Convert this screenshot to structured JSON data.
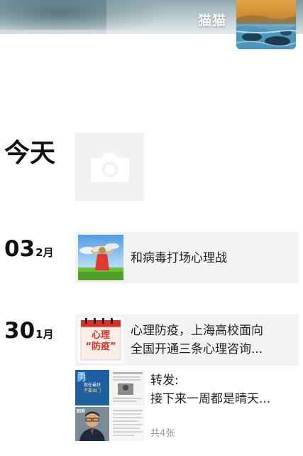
{
  "profile": {
    "nickname": "猫猫",
    "avatar_icon": "landscape-photo-icon"
  },
  "timeline": {
    "today": {
      "label": "今天",
      "placeholder_icon": "camera-icon"
    },
    "entries": [
      {
        "day": "03",
        "month": "2月",
        "text": "和病毒打场心理战",
        "thumb_icon": "girl-in-field-photo-icon"
      },
      {
        "day": "30",
        "month": "1月",
        "line1": "心理防疫，上海高校面向",
        "line2": "全国开通三条心理咨询...",
        "thumb_text_top": "心理",
        "thumb_text_bottom": "“防疫”",
        "thumb_icon": "calendar-poster-icon"
      }
    ],
    "repost": {
      "title": "转发:",
      "text": "接下来一周都是晴天...",
      "count": "共4张",
      "poster_text_1": "勇",
      "poster_text_2": "现在最好",
      "poster_text_3": "不要出门",
      "poster_text_4": "别来"
    }
  },
  "colors": {
    "card_bg": "#f3f3f5",
    "camera_bg": "#f1f1f1",
    "poster_blue": "#1f5f9f",
    "calendar_red": "#d0342c"
  }
}
